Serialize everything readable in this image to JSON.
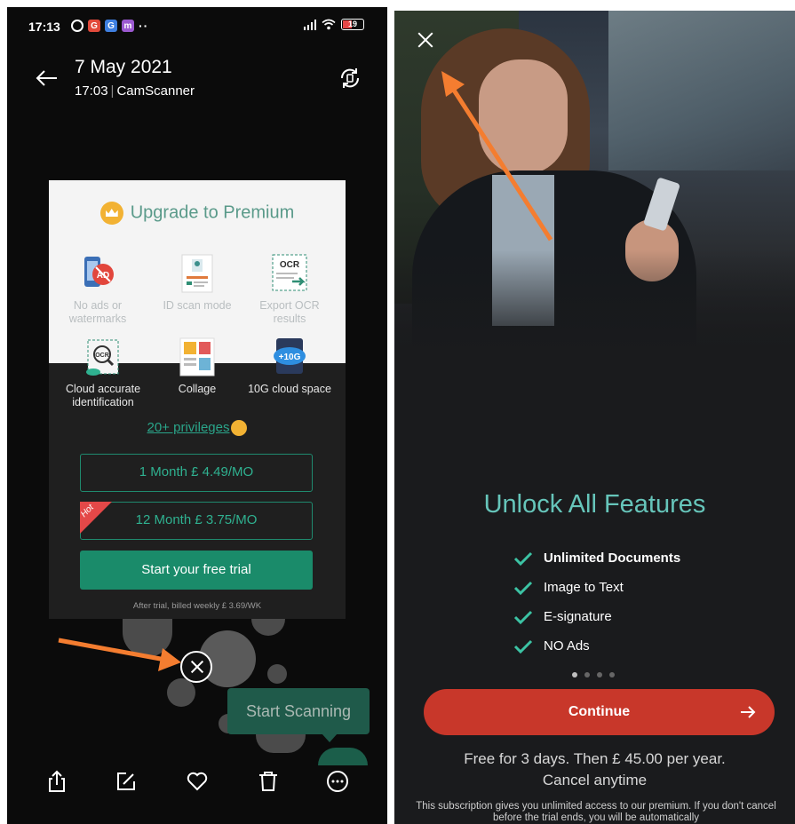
{
  "left_screen": {
    "status_bar": {
      "time": "17:13",
      "battery": "19",
      "more_indicator": "··"
    },
    "header": {
      "date": "7 May 2021",
      "time": "17:03",
      "app": "CamScanner"
    },
    "upgrade": {
      "title": "Upgrade to Premium",
      "features": [
        {
          "label_1": "No ads or",
          "label_2": "watermarks"
        },
        {
          "label_1": "ID scan mode",
          "label_2": ""
        },
        {
          "label_1": "Export OCR",
          "label_2": "results"
        },
        {
          "label_1": "Cloud accurate",
          "label_2": "identification"
        },
        {
          "label_1": "Collage",
          "label_2": ""
        },
        {
          "label_1": "10G cloud space",
          "label_2": ""
        }
      ],
      "icon_ad_text": "AD",
      "icon_ocr_text": "OCR",
      "icon_cloud_text": "+10G",
      "privileges": "20+ privileges",
      "plan_1": "1 Month  £ 4.49/MO",
      "plan_2": "12 Month  £ 3.75/MO",
      "hot_badge": "Hot",
      "trial_button": "Start your free trial",
      "after_trial": "After trial, billed weekly  £ 3.69/WK"
    },
    "tooltip": "Start Scanning",
    "colors": {
      "accent_green": "#1a8b6a",
      "arrow_orange": "#f47d30"
    }
  },
  "right_screen": {
    "headline": "Unlock All Features",
    "benefits": [
      "Unlimited Documents",
      "Image to Text",
      "E-signature",
      "NO Ads"
    ],
    "continue_button": "Continue",
    "free_line_1": "Free for 3 days. Then  £ 45.00 per year.",
    "free_line_2": "Cancel anytime",
    "fine_print": "This subscription gives you unlimited access to our premium. If you don't cancel before the trial ends, you will be automatically",
    "colors": {
      "headline": "#66c5ba",
      "continue_bg": "#c8372a",
      "check": "#3cc3a4"
    }
  }
}
